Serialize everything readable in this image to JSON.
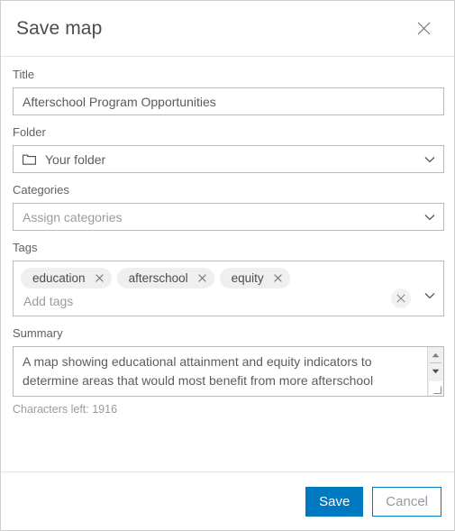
{
  "dialog": {
    "title": "Save map",
    "close_icon": "close-icon"
  },
  "form": {
    "title_field": {
      "label": "Title",
      "value": "Afterschool Program Opportunities"
    },
    "folder_field": {
      "label": "Folder",
      "value": "Your folder",
      "icon": "folder-icon",
      "chevron": "chevron-down-icon"
    },
    "categories_field": {
      "label": "Categories",
      "value": "",
      "placeholder": "Assign categories",
      "chevron": "chevron-down-icon"
    },
    "tags_field": {
      "label": "Tags",
      "tags": [
        "education",
        "afterschool",
        "equity"
      ],
      "placeholder": "Add tags",
      "clear_icon": "close-circle-icon",
      "chevron": "chevron-down-icon"
    },
    "summary_field": {
      "label": "Summary",
      "value": "A map showing educational attainment and equity indicators to determine areas that would most benefit from more afterschool programs.",
      "characters_left": "Characters left: 1916",
      "scroll_up_icon": "triangle-up-icon",
      "scroll_down_icon": "triangle-down-icon",
      "resize_icon": "resize-grip-icon"
    }
  },
  "footer": {
    "save_label": "Save",
    "cancel_label": "Cancel"
  },
  "colors": {
    "accent": "#0079c1",
    "border": "#b9b9b9",
    "label_text": "#616161",
    "placeholder": "#9b9b9b",
    "chip_bg": "#efefef"
  }
}
